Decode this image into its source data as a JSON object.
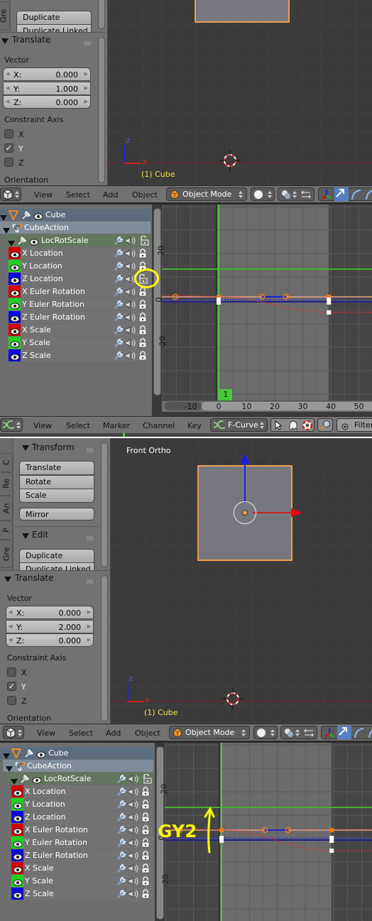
{
  "panels": [
    {
      "tool_shelf": {
        "tabs": [
          "Gre"
        ],
        "edit": {
          "buttons": [
            "Duplicate",
            "Duplicate Linked"
          ]
        }
      },
      "operator": {
        "title": "Translate",
        "vector_label": "Vector",
        "fields": [
          {
            "label": "X:",
            "value": "0.000"
          },
          {
            "label": "Y:",
            "value": "1.000"
          },
          {
            "label": "Z:",
            "value": "0.000"
          }
        ],
        "constraint_label": "Constraint Axis",
        "axes": [
          {
            "label": "X",
            "checked": false
          },
          {
            "label": "Y",
            "checked": true
          },
          {
            "label": "Z",
            "checked": false
          }
        ],
        "orientation_label": "Orientation"
      },
      "viewport": {
        "object_label": "(1) Cube",
        "gizmo": {
          "z": "Z",
          "x": "X"
        }
      },
      "header_3d": {
        "menus": [
          "View",
          "Select",
          "Add",
          "Object"
        ],
        "mode": "Object Mode"
      },
      "channels": {
        "object": "Cube",
        "action": "CubeAction",
        "group": "LocRotScale",
        "items": [
          {
            "label": "X Location",
            "color": "#d40000",
            "locked": true
          },
          {
            "label": "Y Location",
            "color": "#1fd11f",
            "locked": true
          },
          {
            "label": "Z Location",
            "color": "#0a0adc",
            "locked": false
          },
          {
            "label": "X Euler Rotation",
            "color": "#d40000",
            "locked": true
          },
          {
            "label": "Y Euler Rotation",
            "color": "#1fd11f",
            "locked": true
          },
          {
            "label": "Z Euler Rotation",
            "color": "#0a0adc",
            "locked": true
          },
          {
            "label": "X Scale",
            "color": "#d40000",
            "locked": true
          },
          {
            "label": "Y Scale",
            "color": "#1fd11f",
            "locked": true
          },
          {
            "label": "Z Scale",
            "color": "#0a0adc",
            "locked": true
          }
        ]
      },
      "graph": {
        "y_ticks": [
          "20",
          "0",
          "-20"
        ],
        "ruler": [
          "-10",
          "0",
          "10",
          "20",
          "30",
          "40",
          "50"
        ],
        "current_frame": "1"
      },
      "graph_header": {
        "menus": [
          "View",
          "Select",
          "Marker",
          "Channel",
          "Key"
        ],
        "mode": "F-Curve",
        "filters": "Filters"
      },
      "annotation": {
        "type": "circle",
        "color": "#ffff00"
      }
    },
    {
      "tool_shelf": {
        "tabs": [
          "C",
          "Re",
          "An",
          "P",
          "Gre"
        ],
        "transform": {
          "title": "Transform",
          "buttons": [
            "Translate",
            "Rotate",
            "Scale"
          ],
          "mirror": "Mirror"
        },
        "edit": {
          "title": "Edit",
          "buttons": [
            "Duplicate",
            "Duplicate Linked"
          ]
        }
      },
      "operator": {
        "title": "Translate",
        "vector_label": "Vector",
        "fields": [
          {
            "label": "X:",
            "value": "0.000"
          },
          {
            "label": "Y:",
            "value": "2.000"
          },
          {
            "label": "Z:",
            "value": "0.000"
          }
        ],
        "constraint_label": "Constraint Axis",
        "axes": [
          {
            "label": "X",
            "checked": false
          },
          {
            "label": "Y",
            "checked": true
          },
          {
            "label": "Z",
            "checked": false
          }
        ],
        "orientation_label": "Orientation"
      },
      "viewport": {
        "view_label": "Front Ortho",
        "object_label": "(1) Cube",
        "gizmo": {
          "z": "Z",
          "x": "X"
        }
      },
      "header_3d": {
        "menus": [
          "View",
          "Select",
          "Add",
          "Object"
        ],
        "mode": "Object Mode"
      },
      "channels": {
        "object": "Cube",
        "action": "CubeAction",
        "group": "LocRotScale",
        "items": [
          {
            "label": "X Location",
            "color": "#d40000",
            "locked": true
          },
          {
            "label": "Y Location",
            "color": "#1fd11f",
            "locked": true
          },
          {
            "label": "Z Location",
            "color": "#0a0adc",
            "locked": true
          },
          {
            "label": "X Euler Rotation",
            "color": "#d40000",
            "locked": true
          },
          {
            "label": "Y Euler Rotation",
            "color": "#1fd11f",
            "locked": true
          },
          {
            "label": "Z Euler Rotation",
            "color": "#0a0adc",
            "locked": true
          },
          {
            "label": "X Scale",
            "color": "#d40000",
            "locked": true
          },
          {
            "label": "Y Scale",
            "color": "#1fd11f",
            "locked": true
          },
          {
            "label": "Z Scale",
            "color": "#0a0adc",
            "locked": true
          }
        ]
      },
      "graph": {
        "y_ticks": [
          "20",
          "0",
          "-20"
        ]
      },
      "annotation": {
        "type": "text-arrow",
        "text": "GY2",
        "color": "#ffff00"
      }
    }
  ],
  "colors": {
    "selection_outline": "#f0a040",
    "cursor_green": "#4cc63c",
    "object_label": "#ffff00"
  }
}
